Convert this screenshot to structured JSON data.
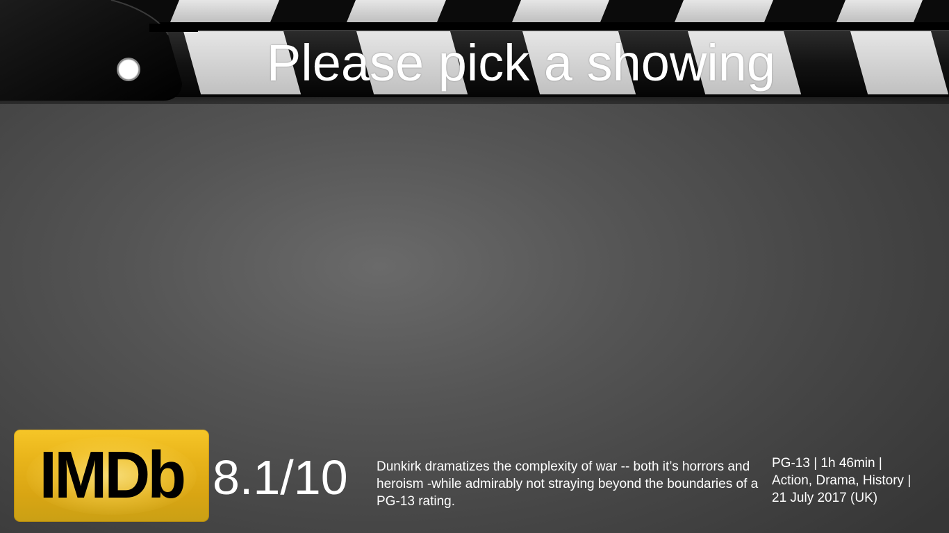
{
  "header": {
    "title": "Please pick a showing"
  },
  "movie": {
    "imdb_logo_text": "IMDb",
    "rating": "8.1/10",
    "synopsis": "Dunkirk dramatizes the complexity of war -- both it’s horrors and heroism -while admirably not straying beyond the boundaries of a PG-13 rating.",
    "meta_lines": [
      "PG-13 | 1h 46min |",
      "Action, Drama, History |",
      "21 July 2017 (UK)"
    ]
  },
  "colors": {
    "imdb_yellow": "#E6B31E",
    "text": "#FFFFFF",
    "clapper_black": "#0A0A0A",
    "clapper_stripe": "#D4D4D4"
  },
  "icons": {
    "hinge": "hinge-circle-icon"
  }
}
